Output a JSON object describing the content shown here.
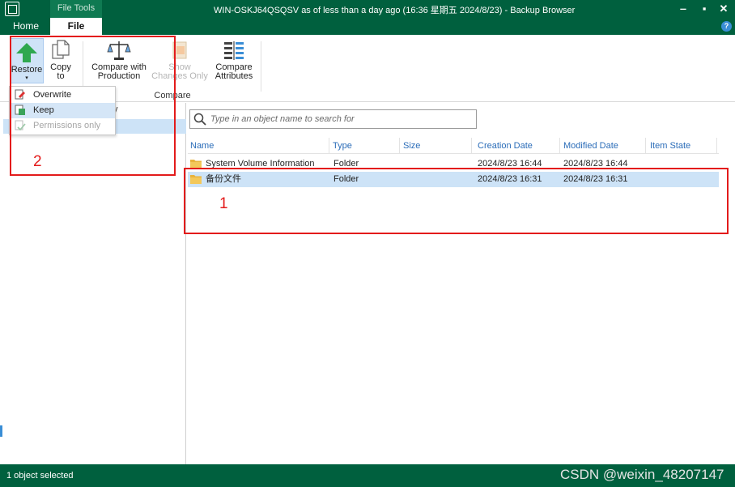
{
  "window": {
    "title": "WIN-OSKJ64QSQSV as of less than a day ago (16:36 星期五 2024/8/23) - Backup Browser",
    "context_tab": "File Tools",
    "controls": {
      "minimize": "‒",
      "maximize": "▪",
      "close": "✕"
    }
  },
  "tabs": {
    "home": "Home",
    "file": "File",
    "help": "?"
  },
  "ribbon": {
    "restore_label": "Restore",
    "restore_caret": "▾",
    "copy_to_label_1": "Copy",
    "copy_to_label_2": "to",
    "compare_production_label_1": "Compare with",
    "compare_production_label_2": "Production",
    "show_changes_label_1": "Show",
    "show_changes_label_2": "Changes Only",
    "compare_attributes_label_1": "Compare",
    "compare_attributes_label_2": "Attributes",
    "group_label": "Compare"
  },
  "restore_menu": {
    "items": [
      {
        "label": "Overwrite",
        "enabled": true
      },
      {
        "label": "Keep",
        "enabled": true,
        "highlighted": true
      },
      {
        "label": "Permissions only",
        "enabled": false
      }
    ]
  },
  "tree": {
    "fragment": "y"
  },
  "search": {
    "placeholder": "Type in an object name to search for",
    "value": ""
  },
  "table": {
    "columns": [
      "Name",
      "Type",
      "Size",
      "Creation Date",
      "Modified Date",
      "Item State"
    ],
    "rows": [
      {
        "name": "System Volume Information",
        "type": "Folder",
        "size": "",
        "created": "2024/8/23 16:44",
        "modified": "2024/8/23 16:44",
        "state": "",
        "selected": false
      },
      {
        "name": "备份文件",
        "type": "Folder",
        "size": "",
        "created": "2024/8/23 16:31",
        "modified": "2024/8/23 16:31",
        "state": "",
        "selected": true
      }
    ]
  },
  "status": {
    "text": "1 object selected"
  },
  "watermark": "CSDN @weixin_48207147",
  "annotations": {
    "label_1": "1",
    "label_2": "2"
  },
  "colors": {
    "brand_green": "#00603e",
    "selection_blue": "#cde3f7",
    "annotation_red": "#e31b1b",
    "header_blue": "#2a6cb8"
  }
}
